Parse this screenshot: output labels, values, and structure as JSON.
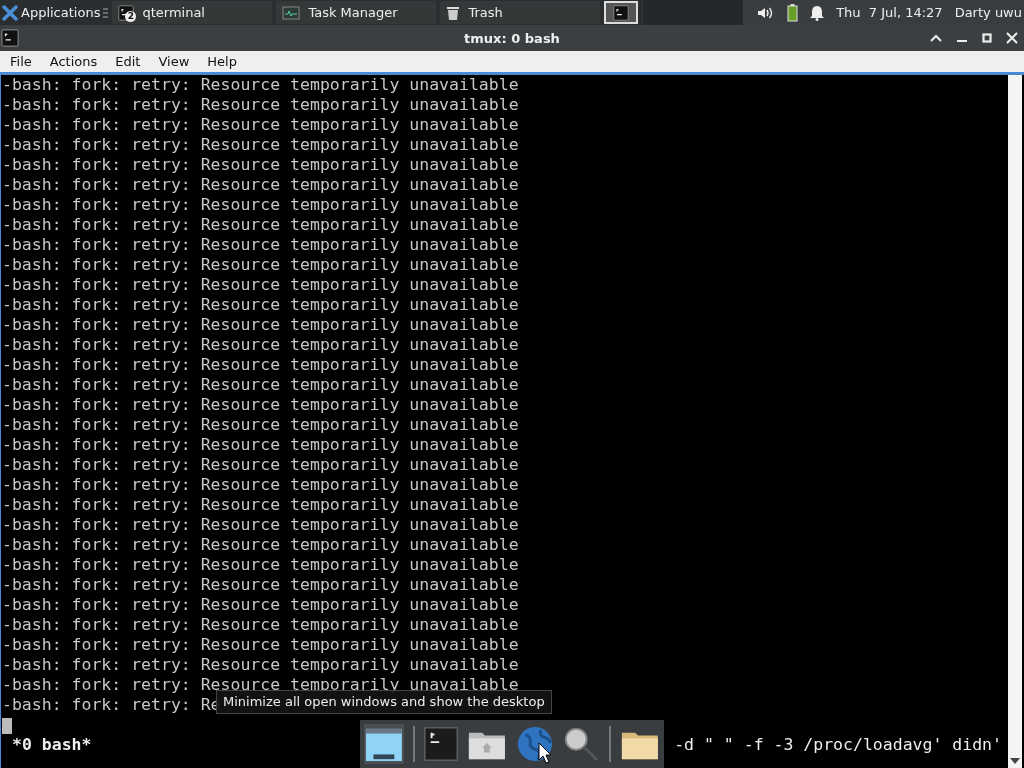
{
  "panel": {
    "app_menu": "Applications",
    "tasks": [
      {
        "kind": "terminal",
        "label": "qterminal",
        "badge": "2",
        "selected": false
      },
      {
        "kind": "monitor",
        "label": "Task Manager",
        "selected": false
      },
      {
        "kind": "trash",
        "label": "Trash",
        "selected": false
      },
      {
        "kind": "terminal",
        "selected": true
      }
    ],
    "clock": "Thu  7 Jul, 14:27",
    "user": "Darty uwu"
  },
  "window": {
    "title": "tmux: 0 bash"
  },
  "menu": [
    "File",
    "Actions",
    "Edit",
    "View",
    "Help"
  ],
  "terminal": {
    "lines": [
      "-bash: fork: retry: Resource temporarily unavailable",
      "-bash: fork: retry: Resource temporarily unavailable",
      "-bash: fork: retry: Resource temporarily unavailable",
      "-bash: fork: retry: Resource temporarily unavailable",
      "-bash: fork: retry: Resource temporarily unavailable",
      "-bash: fork: retry: Resource temporarily unavailable",
      "-bash: fork: retry: Resource temporarily unavailable",
      "-bash: fork: retry: Resource temporarily unavailable",
      "-bash: fork: retry: Resource temporarily unavailable",
      "-bash: fork: retry: Resource temporarily unavailable",
      "-bash: fork: retry: Resource temporarily unavailable",
      "-bash: fork: retry: Resource temporarily unavailable",
      "-bash: fork: retry: Resource temporarily unavailable",
      "-bash: fork: retry: Resource temporarily unavailable",
      "-bash: fork: retry: Resource temporarily unavailable",
      "-bash: fork: retry: Resource temporarily unavailable",
      "-bash: fork: retry: Resource temporarily unavailable",
      "-bash: fork: retry: Resource temporarily unavailable",
      "-bash: fork: retry: Resource temporarily unavailable",
      "-bash: fork: retry: Resource temporarily unavailable",
      "-bash: fork: retry: Resource temporarily unavailable",
      "-bash: fork: retry: Resource temporarily unavailable",
      "-bash: fork: retry: Resource temporarily unavailable",
      "-bash: fork: retry: Resource temporarily unavailable",
      "-bash: fork: retry: Resource temporarily unavailable",
      "-bash: fork: retry: Resource temporarily unavailable",
      "-bash: fork: retry: Resource temporarily unavailable",
      "-bash: fork: retry: Resource temporarily unavailable",
      "-bash: fork: retry: Resource temporarily unavailable",
      "-bash: fork: retry: Resource temporarily unavailable",
      "-bash: fork: retry: Resource temporarily unavailable",
      "-bash: fork: retry: Re"
    ],
    "status_left": "*0 bash*",
    "status_right": "-d \" \" -f -3 /proc/loadavg' didn'"
  },
  "tooltip": {
    "text": "Minimize all open windows and show the desktop"
  },
  "dock": {
    "items": [
      {
        "kind": "desktop"
      },
      {
        "kind": "separator"
      },
      {
        "kind": "terminal"
      },
      {
        "kind": "home"
      },
      {
        "kind": "globe"
      },
      {
        "kind": "search"
      },
      {
        "kind": "separator"
      },
      {
        "kind": "folder"
      }
    ]
  }
}
